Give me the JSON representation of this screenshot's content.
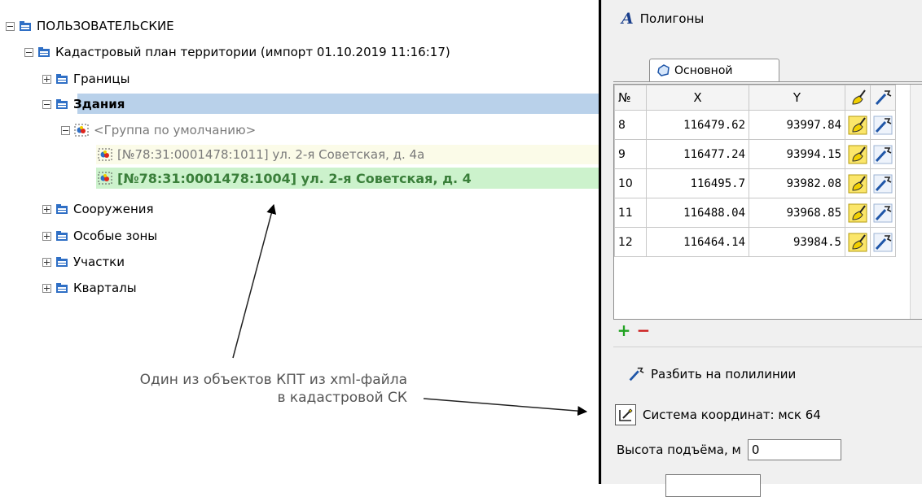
{
  "tree": {
    "root": "ПОЛЬЗОВАТЕЛЬСКИЕ",
    "plan": "Кадастровый план территории (импорт 01.10.2019 11:16:17)",
    "items_top": [
      "Границы",
      "Здания"
    ],
    "group": "<Группа по умолчанию>",
    "objects": [
      "[№78:31:0001478:1011] ул. 2-я Советская, д. 4а",
      "[№78:31:0001478:1004] ул. 2-я Советская, д. 4"
    ],
    "items_bottom": [
      "Сооружения",
      "Особые зоны",
      "Участки",
      "Кварталы"
    ]
  },
  "annotation": {
    "line1": "Один из объектов КПТ из xml-файла",
    "line2": "в кадастровой СК"
  },
  "panel": {
    "title_letter": "A",
    "title": "Полигоны",
    "tab": "Основной",
    "table": {
      "headers": [
        "№",
        "X",
        "Y"
      ],
      "rows": [
        [
          "8",
          "116479.62",
          "93997.84"
        ],
        [
          "9",
          "116477.24",
          "93994.15"
        ],
        [
          "10",
          "116495.7",
          "93982.08"
        ],
        [
          "11",
          "116488.04",
          "93968.85"
        ],
        [
          "12",
          "116464.14",
          "93984.5"
        ]
      ]
    },
    "add": "+",
    "remove": "−",
    "split_label": "Разбить на полилинии",
    "coord_system": "Система координат:  мск 64",
    "height_label": "Высота подъёма, м",
    "height_value": "0"
  },
  "colors": {
    "selection": "#b9d1ea",
    "highlight_green": "#ccf2cc",
    "highlight_yellow": "#fbfbe8",
    "folder_blue": "#2f6fc5",
    "icon_yellow": "#f2d000"
  },
  "icons": [
    "folder-icon",
    "group-object-icon",
    "building-object-icon",
    "polygon-tab-icon",
    "brush-icon",
    "wand-icon",
    "edit-coords-icon"
  ]
}
